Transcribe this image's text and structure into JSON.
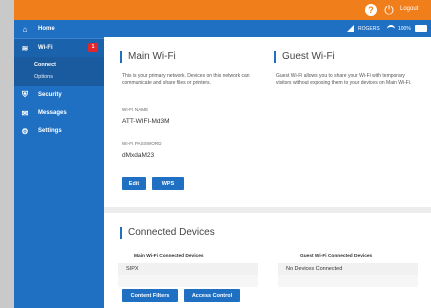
{
  "topbar": {
    "help_icon": "help-icon",
    "power_icon": "power-icon",
    "logout_label": "Logout"
  },
  "status": {
    "carrier": "ROGERS",
    "battery_percent": "100%"
  },
  "sidebar": {
    "items": [
      {
        "label": "Home",
        "icon": "home-icon"
      },
      {
        "label": "Wi-Fi",
        "icon": "wifi-icon",
        "badge": "1"
      },
      {
        "label": "Security",
        "icon": "shield-icon"
      },
      {
        "label": "Messages",
        "icon": "envelope-icon"
      },
      {
        "label": "Settings",
        "icon": "gear-icon"
      }
    ],
    "subitems": [
      {
        "label": "Connect"
      },
      {
        "label": "Options"
      }
    ]
  },
  "main_wifi": {
    "title": "Main Wi-Fi",
    "description": "This is your primary network. Devices on this network can communicate and share files or printers.",
    "name_label": "WI-FI NAME",
    "name_value": "ATT-WIFI-Md3M",
    "password_label": "WI-FI PASSWORD",
    "password_value": "dMxdaM23",
    "edit_label": "Edit",
    "wps_label": "WPS"
  },
  "guest_wifi": {
    "title": "Guest Wi-Fi",
    "description": "Guest Wi-Fi allows you to share your Wi-Fi with temporary visitors without exposing them to your devices on Main Wi-Fi."
  },
  "devices": {
    "title": "Connected Devices",
    "main_header": "Main Wi-Fi Connected Devices",
    "guest_header": "Guest Wi-Fi Connected Devices",
    "main_rows": [
      "SIPX",
      ""
    ],
    "guest_rows": [
      "No Devices Connected",
      ""
    ],
    "content_filters_label": "Content Filters",
    "access_control_label": "Access Control"
  },
  "colors": {
    "accent_orange": "#f07e1b",
    "primary_blue": "#1f6fc3",
    "badge_red": "#e2262b"
  }
}
